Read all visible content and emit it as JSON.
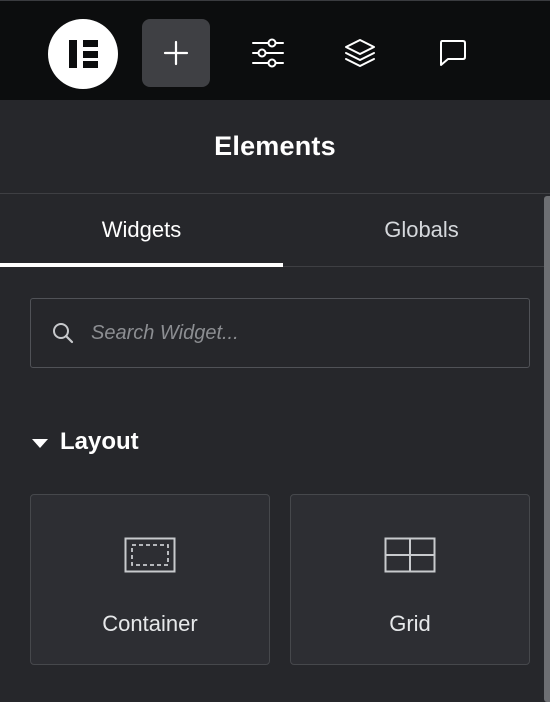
{
  "toolbar": {
    "logo_icon": "elementor-logo-icon",
    "buttons": [
      {
        "icon": "plus-icon",
        "active": true
      },
      {
        "icon": "sliders-icon",
        "active": false
      },
      {
        "icon": "layers-icon",
        "active": false
      },
      {
        "icon": "comment-icon",
        "active": false
      }
    ]
  },
  "header": {
    "title": "Elements"
  },
  "tabs": [
    {
      "label": "Widgets",
      "active": true
    },
    {
      "label": "Globals",
      "active": false
    }
  ],
  "search": {
    "placeholder": "Search Widget...",
    "value": "",
    "icon": "search-icon"
  },
  "sections": [
    {
      "title": "Layout",
      "expanded": true,
      "widgets": [
        {
          "label": "Container",
          "icon": "container-icon"
        },
        {
          "label": "Grid",
          "icon": "grid-icon"
        }
      ]
    }
  ],
  "colors": {
    "toolbar_bg": "#0c0d0e",
    "panel_bg": "#26272b",
    "card_bg": "#2d2e33",
    "border": "#46484c",
    "text": "#ffffff",
    "active_button_bg": "#3f4044"
  }
}
